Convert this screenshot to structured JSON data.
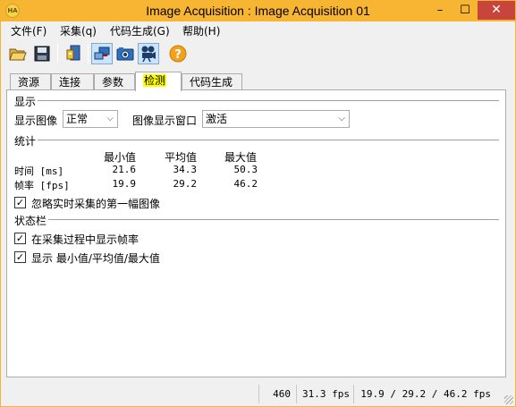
{
  "window": {
    "title": "Image Acquisition : Image Acquisition 01",
    "app_icon": "halcon-logo",
    "controls": {
      "minimize": "–",
      "maximize": "☐",
      "close": "✕"
    }
  },
  "menu": [
    {
      "label": "文件(F)"
    },
    {
      "label": "采集(q)"
    },
    {
      "label": "代码生成(G)"
    },
    {
      "label": "帮助(H)"
    }
  ],
  "toolbar": [
    {
      "icon": "open-folder-icon"
    },
    {
      "icon": "save-disk-icon"
    },
    {
      "icon": "image-properties-icon"
    },
    {
      "icon": "connect-icon",
      "pressed": true
    },
    {
      "icon": "snap-camera-icon"
    },
    {
      "icon": "live-video-camera-icon",
      "pressed": true
    },
    {
      "icon": "help-icon",
      "glyph": "?"
    }
  ],
  "tabs": [
    {
      "label": "资源",
      "active": false
    },
    {
      "label": "连接",
      "active": false
    },
    {
      "label": "参数",
      "active": false
    },
    {
      "label": "检测",
      "active": true
    },
    {
      "label": "代码生成",
      "active": false
    }
  ],
  "display": {
    "section_title": "显示",
    "show_image_label": "显示图像",
    "show_image_value": "正常",
    "window_label": "图像显示窗口",
    "window_value": "激活"
  },
  "stats": {
    "section_title": "统计",
    "headers": [
      "最小值",
      "平均值",
      "最大值"
    ],
    "rows": [
      {
        "label": "时间 [ms]",
        "min": "21.6",
        "avg": "34.3",
        "max": "50.3"
      },
      {
        "label": "帧率 [fps]",
        "min": "19.9",
        "avg": "29.2",
        "max": "46.2"
      }
    ],
    "ignore_first_label": "忽略实时采集的第一幅图像",
    "ignore_first_checked": true
  },
  "statusbar_section": {
    "section_title": "状态栏",
    "show_fps_label": "在采集过程中显示帧率",
    "show_fps_checked": true,
    "show_minmax_label": "显示 最小值/平均值/最大值",
    "show_minmax_checked": true
  },
  "status": {
    "count": "460",
    "fps": "31.3 fps",
    "minavgmax": "19.9 / 29.2 / 46.2 fps"
  },
  "check_glyph": "✓"
}
